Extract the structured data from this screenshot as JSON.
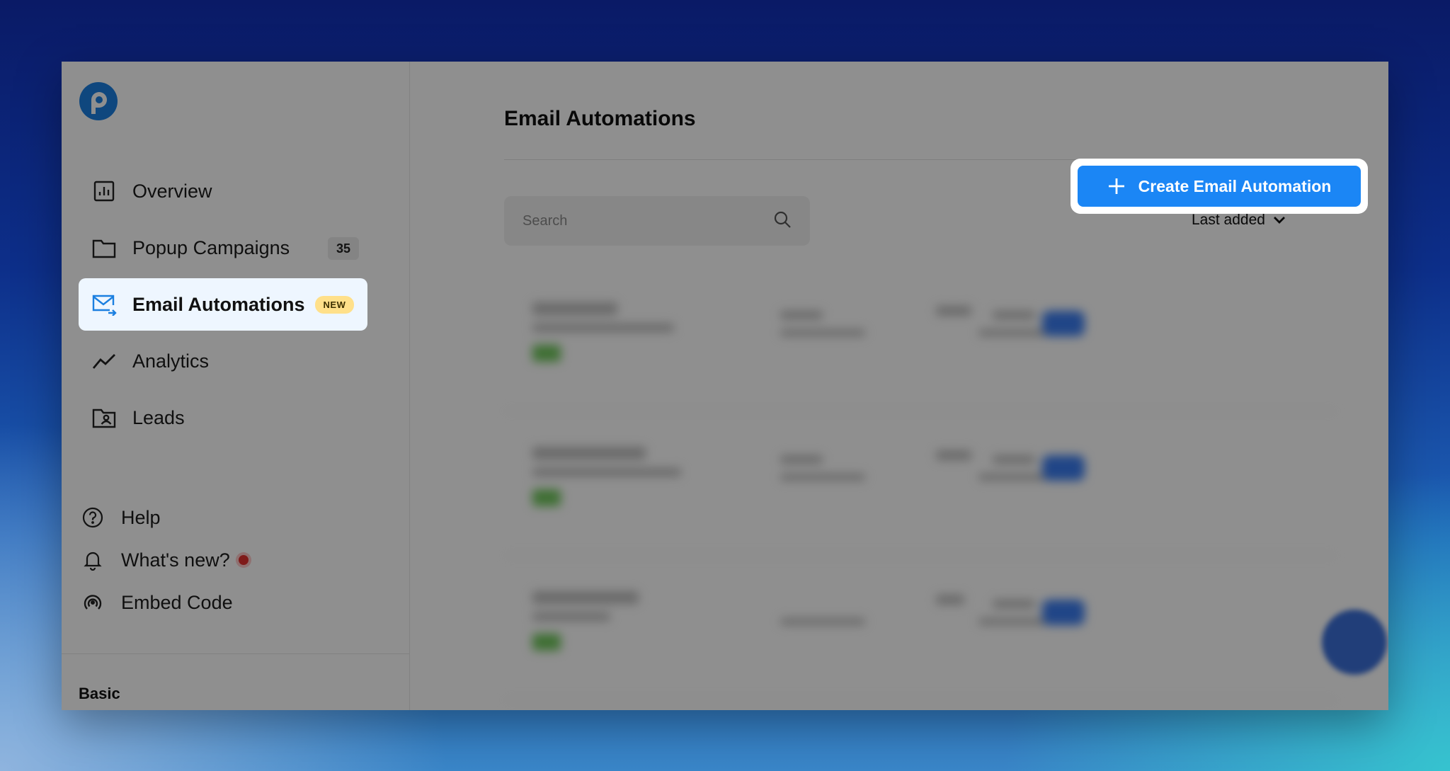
{
  "nav": {
    "items": [
      {
        "label": "Overview",
        "icon": "overview-chart-icon"
      },
      {
        "label": "Popup Campaigns",
        "icon": "folder-icon",
        "count": "35"
      },
      {
        "label": "Email Automations",
        "icon": "email-automation-icon",
        "badge": "NEW",
        "active": true
      },
      {
        "label": "Analytics",
        "icon": "trend-line-icon"
      },
      {
        "label": "Leads",
        "icon": "folder-contact-icon"
      }
    ],
    "utility": [
      {
        "label": "Help",
        "icon": "help-circle-icon"
      },
      {
        "label": "What's new?",
        "icon": "bell-icon"
      },
      {
        "label": "Embed Code",
        "icon": "broadcast-icon"
      }
    ],
    "plan": "Basic"
  },
  "main": {
    "title": "Email Automations",
    "create_label": "Create Email Automation",
    "search_placeholder": "Search",
    "sort_label": "Last added"
  },
  "colors": {
    "brand_blue": "#1b86f5",
    "new_badge": "#ffe08a",
    "notification_dot": "#e2302f"
  }
}
